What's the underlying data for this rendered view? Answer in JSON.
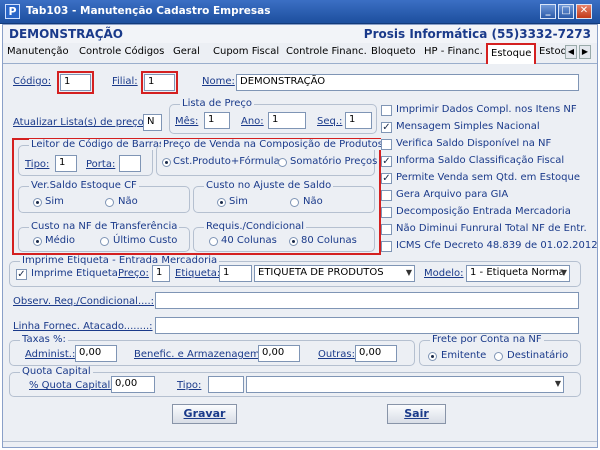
{
  "window": {
    "title": "Tab103 - Manutenção Cadastro Empresas",
    "app_icon_letter": "P"
  },
  "header": {
    "company": "DEMONSTRAÇÃO",
    "contact": "Prosis Informática (55)3332-7273"
  },
  "tabs": [
    "Manutenção",
    "Controle Códigos",
    "Geral",
    "Cupom Fiscal",
    "Controle Financ.",
    "Bloqueto",
    "HP - Financ.",
    "Estoque",
    "Estoq"
  ],
  "fields": {
    "codigo_label": "Código:",
    "codigo": "1",
    "filial_label": "Filial:",
    "filial": "1",
    "nome_label": "Nome:",
    "nome": "DEMONSTRAÇÃO"
  },
  "lista_preco": {
    "atualizar_label": "Atualizar Lista(s) de preço:",
    "atualizar": "N",
    "group": "Lista de Preço",
    "mes_label": "Mês:",
    "mes": "1",
    "ano_label": "Ano:",
    "ano": "1",
    "seq_label": "Seq.:",
    "seq": "1"
  },
  "leitor": {
    "group": "Leitor de Código de Barras",
    "tipo_label": "Tipo:",
    "tipo": "1",
    "porta_label": "Porta:",
    "porta": ""
  },
  "preco_venda": {
    "group": "Preço de Venda na Composição de Produtos",
    "opt1": "Cst.Produto+Fórmula",
    "opt2": "Somatório Preços"
  },
  "ver_saldo": {
    "group": "Ver.Saldo Estoque CF",
    "sim": "Sim",
    "nao": "Não"
  },
  "custo_ajuste": {
    "group": "Custo no Ajuste de Saldo",
    "sim": "Sim",
    "nao": "Não"
  },
  "custo_nf": {
    "group": "Custo na NF de Transferência",
    "opt1": "Médio",
    "opt2": "Último Custo"
  },
  "requis": {
    "group": "Requis./Condicional",
    "opt1": "40 Colunas",
    "opt2": "80 Colunas"
  },
  "checks": [
    {
      "label": "Imprimir Dados Compl. nos Itens NF",
      "checked": false
    },
    {
      "label": "Mensagem Simples Nacional",
      "checked": true
    },
    {
      "label": "Verifica Saldo Disponível na NF",
      "checked": false
    },
    {
      "label": "Informa Saldo Classificação Fiscal",
      "checked": true
    },
    {
      "label": "Permite Venda sem Qtd. em Estoque",
      "checked": true
    },
    {
      "label": "Gera Arquivo para GIA",
      "checked": false
    },
    {
      "label": "Decomposição Entrada Mercadoria",
      "checked": false
    },
    {
      "label": "Não Diminui Funrural Total NF de Entr.",
      "checked": false
    },
    {
      "label": "ICMS Cfe Decreto 48.839 de 01.02.2012",
      "checked": false
    }
  ],
  "etiqueta": {
    "group": "Imprime Etiqueta - Entrada Mercadoria",
    "imprime_label": "Imprime Etiqueta",
    "preco_label": "Preço:",
    "preco": "1",
    "etiqueta_label": "Etiqueta:",
    "etiqueta": "1",
    "etiqueta_select": "ETIQUETA DE PRODUTOS",
    "modelo_label": "Modelo:",
    "modelo": "1 - Etiqueta Norma"
  },
  "observ_label": "Observ. Req./Condicional....:",
  "linha_label": "Linha Fornec. Atacado........:",
  "taxas": {
    "group": "Taxas %:",
    "administ_label": "Administ.:",
    "administ": "0,00",
    "benefic_label": "Benefic. e Armazenagem:",
    "benefic": "0,00",
    "outras_label": "Outras:",
    "outras": "0,00"
  },
  "frete": {
    "group": "Frete por Conta na NF",
    "opt1": "Emitente",
    "opt2": "Destinatário"
  },
  "quota": {
    "group": "Quota Capital",
    "pct_label": "% Quota Capital:",
    "pct": "0,00",
    "tipo_label": "Tipo:"
  },
  "buttons": {
    "gravar": "Gravar",
    "sair": "Sair"
  }
}
